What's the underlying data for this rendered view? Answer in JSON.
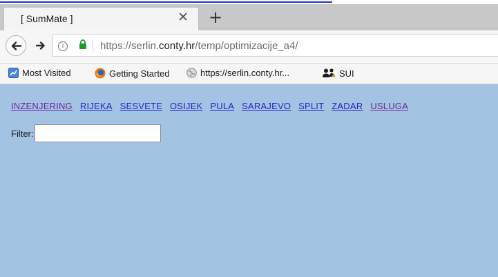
{
  "browser": {
    "tab": {
      "title": "[ SumMate ]",
      "close_glyph": "✕"
    },
    "new_tab_glyph": "+",
    "url": {
      "prefix": "https://serlin.",
      "domain": "conty.hr",
      "path": "/temp/optimizacije_a4/"
    },
    "bookmarks": [
      {
        "label": "Most Visited",
        "icon": "most-visited-icon"
      },
      {
        "label": "Getting Started",
        "icon": "firefox-icon"
      },
      {
        "label": "https://serlin.conty.hr...",
        "icon": "globe-icon"
      },
      {
        "label": "SUI",
        "icon": "users-icon"
      }
    ]
  },
  "page": {
    "nav_links": [
      {
        "label": "INZENJERING",
        "visited": true
      },
      {
        "label": "RIJEKA",
        "visited": false
      },
      {
        "label": "SESVETE",
        "visited": false
      },
      {
        "label": "OSIJEK",
        "visited": false
      },
      {
        "label": "PULA",
        "visited": false
      },
      {
        "label": "SARAJEVO",
        "visited": false
      },
      {
        "label": "SPLIT",
        "visited": false
      },
      {
        "label": "ZADAR",
        "visited": false
      },
      {
        "label": "USLUGA",
        "visited": true
      }
    ],
    "filter": {
      "label": "Filter:",
      "value": ""
    },
    "background": "#a3c3e3",
    "link_color": "#2424c8",
    "visited_link_color": "#6a2a9a"
  }
}
